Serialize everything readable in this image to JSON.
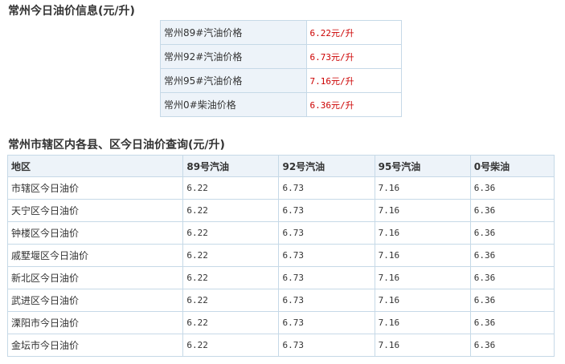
{
  "section1": {
    "title": "常州今日油价信息(元/升)",
    "rows": [
      {
        "label": "常州89#汽油价格",
        "price": "6.22元/升"
      },
      {
        "label": "常州92#汽油价格",
        "price": "6.73元/升"
      },
      {
        "label": "常州95#汽油价格",
        "price": "7.16元/升"
      },
      {
        "label": "常州0#柴油价格",
        "price": "6.36元/升"
      }
    ],
    "colors": {
      "label_bg": "#edf3f9",
      "price_text": "#cc0000",
      "border": "#c6d9e7"
    }
  },
  "section2": {
    "title": "常州市辖区内各县、区今日油价查询(元/升)",
    "headers": [
      "地区",
      "89号汽油",
      "92号汽油",
      "95号汽油",
      "0号柴油"
    ],
    "rows": [
      [
        "市辖区今日油价",
        "6.22",
        "6.73",
        "7.16",
        "6.36"
      ],
      [
        "天宁区今日油价",
        "6.22",
        "6.73",
        "7.16",
        "6.36"
      ],
      [
        "钟楼区今日油价",
        "6.22",
        "6.73",
        "7.16",
        "6.36"
      ],
      [
        "戚墅堰区今日油价",
        "6.22",
        "6.73",
        "7.16",
        "6.36"
      ],
      [
        "新北区今日油价",
        "6.22",
        "6.73",
        "7.16",
        "6.36"
      ],
      [
        "武进区今日油价",
        "6.22",
        "6.73",
        "7.16",
        "6.36"
      ],
      [
        "溧阳市今日油价",
        "6.22",
        "6.73",
        "7.16",
        "6.36"
      ],
      [
        "金坛市今日油价",
        "6.22",
        "6.73",
        "7.16",
        "6.36"
      ]
    ]
  }
}
